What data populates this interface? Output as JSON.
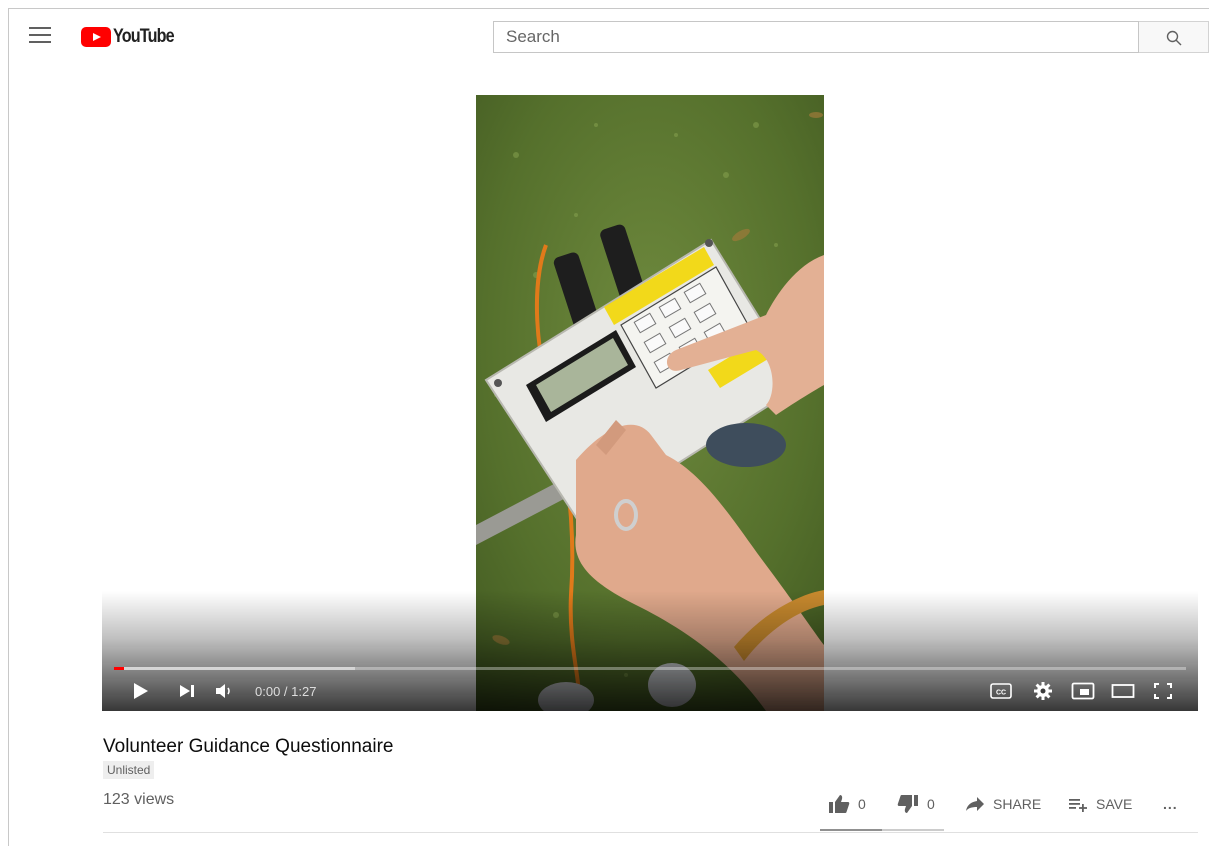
{
  "masthead": {
    "logo_text": "YouTube",
    "search_placeholder": "Search"
  },
  "player": {
    "time_current": "0:00",
    "time_separator": " / ",
    "time_total": "1:27",
    "played_fraction": 0.009,
    "buffered_fraction": 0.225,
    "accent_color": "#ff0000"
  },
  "video": {
    "title": "Volunteer Guidance Questionnaire",
    "privacy_badge": "Unlisted",
    "views": "123 views",
    "likes": "0",
    "dislikes": "0",
    "share_label": "SHARE",
    "save_label": "SAVE",
    "more_label": "..."
  },
  "icons": [
    "menu-icon",
    "youtube-logo-icon",
    "search-icon",
    "play-icon",
    "next-icon",
    "volume-icon",
    "captions-icon",
    "settings-icon",
    "miniplayer-icon",
    "theater-icon",
    "fullscreen-icon",
    "like-icon",
    "dislike-icon",
    "share-icon",
    "save-playlist-icon",
    "more-icon"
  ]
}
